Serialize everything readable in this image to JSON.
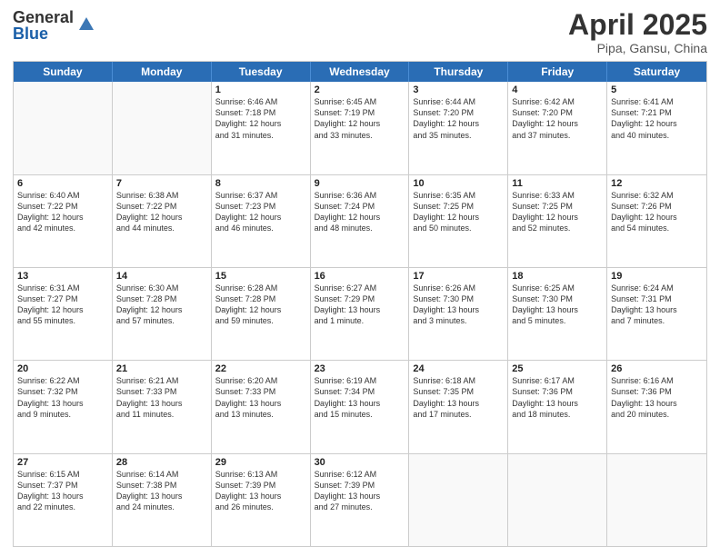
{
  "header": {
    "logo_general": "General",
    "logo_blue": "Blue",
    "title": "April 2025",
    "location": "Pipa, Gansu, China"
  },
  "weekdays": [
    "Sunday",
    "Monday",
    "Tuesday",
    "Wednesday",
    "Thursday",
    "Friday",
    "Saturday"
  ],
  "rows": [
    [
      {
        "day": "",
        "text": ""
      },
      {
        "day": "",
        "text": ""
      },
      {
        "day": "1",
        "text": "Sunrise: 6:46 AM\nSunset: 7:18 PM\nDaylight: 12 hours\nand 31 minutes."
      },
      {
        "day": "2",
        "text": "Sunrise: 6:45 AM\nSunset: 7:19 PM\nDaylight: 12 hours\nand 33 minutes."
      },
      {
        "day": "3",
        "text": "Sunrise: 6:44 AM\nSunset: 7:20 PM\nDaylight: 12 hours\nand 35 minutes."
      },
      {
        "day": "4",
        "text": "Sunrise: 6:42 AM\nSunset: 7:20 PM\nDaylight: 12 hours\nand 37 minutes."
      },
      {
        "day": "5",
        "text": "Sunrise: 6:41 AM\nSunset: 7:21 PM\nDaylight: 12 hours\nand 40 minutes."
      }
    ],
    [
      {
        "day": "6",
        "text": "Sunrise: 6:40 AM\nSunset: 7:22 PM\nDaylight: 12 hours\nand 42 minutes."
      },
      {
        "day": "7",
        "text": "Sunrise: 6:38 AM\nSunset: 7:22 PM\nDaylight: 12 hours\nand 44 minutes."
      },
      {
        "day": "8",
        "text": "Sunrise: 6:37 AM\nSunset: 7:23 PM\nDaylight: 12 hours\nand 46 minutes."
      },
      {
        "day": "9",
        "text": "Sunrise: 6:36 AM\nSunset: 7:24 PM\nDaylight: 12 hours\nand 48 minutes."
      },
      {
        "day": "10",
        "text": "Sunrise: 6:35 AM\nSunset: 7:25 PM\nDaylight: 12 hours\nand 50 minutes."
      },
      {
        "day": "11",
        "text": "Sunrise: 6:33 AM\nSunset: 7:25 PM\nDaylight: 12 hours\nand 52 minutes."
      },
      {
        "day": "12",
        "text": "Sunrise: 6:32 AM\nSunset: 7:26 PM\nDaylight: 12 hours\nand 54 minutes."
      }
    ],
    [
      {
        "day": "13",
        "text": "Sunrise: 6:31 AM\nSunset: 7:27 PM\nDaylight: 12 hours\nand 55 minutes."
      },
      {
        "day": "14",
        "text": "Sunrise: 6:30 AM\nSunset: 7:28 PM\nDaylight: 12 hours\nand 57 minutes."
      },
      {
        "day": "15",
        "text": "Sunrise: 6:28 AM\nSunset: 7:28 PM\nDaylight: 12 hours\nand 59 minutes."
      },
      {
        "day": "16",
        "text": "Sunrise: 6:27 AM\nSunset: 7:29 PM\nDaylight: 13 hours\nand 1 minute."
      },
      {
        "day": "17",
        "text": "Sunrise: 6:26 AM\nSunset: 7:30 PM\nDaylight: 13 hours\nand 3 minutes."
      },
      {
        "day": "18",
        "text": "Sunrise: 6:25 AM\nSunset: 7:30 PM\nDaylight: 13 hours\nand 5 minutes."
      },
      {
        "day": "19",
        "text": "Sunrise: 6:24 AM\nSunset: 7:31 PM\nDaylight: 13 hours\nand 7 minutes."
      }
    ],
    [
      {
        "day": "20",
        "text": "Sunrise: 6:22 AM\nSunset: 7:32 PM\nDaylight: 13 hours\nand 9 minutes."
      },
      {
        "day": "21",
        "text": "Sunrise: 6:21 AM\nSunset: 7:33 PM\nDaylight: 13 hours\nand 11 minutes."
      },
      {
        "day": "22",
        "text": "Sunrise: 6:20 AM\nSunset: 7:33 PM\nDaylight: 13 hours\nand 13 minutes."
      },
      {
        "day": "23",
        "text": "Sunrise: 6:19 AM\nSunset: 7:34 PM\nDaylight: 13 hours\nand 15 minutes."
      },
      {
        "day": "24",
        "text": "Sunrise: 6:18 AM\nSunset: 7:35 PM\nDaylight: 13 hours\nand 17 minutes."
      },
      {
        "day": "25",
        "text": "Sunrise: 6:17 AM\nSunset: 7:36 PM\nDaylight: 13 hours\nand 18 minutes."
      },
      {
        "day": "26",
        "text": "Sunrise: 6:16 AM\nSunset: 7:36 PM\nDaylight: 13 hours\nand 20 minutes."
      }
    ],
    [
      {
        "day": "27",
        "text": "Sunrise: 6:15 AM\nSunset: 7:37 PM\nDaylight: 13 hours\nand 22 minutes."
      },
      {
        "day": "28",
        "text": "Sunrise: 6:14 AM\nSunset: 7:38 PM\nDaylight: 13 hours\nand 24 minutes."
      },
      {
        "day": "29",
        "text": "Sunrise: 6:13 AM\nSunset: 7:39 PM\nDaylight: 13 hours\nand 26 minutes."
      },
      {
        "day": "30",
        "text": "Sunrise: 6:12 AM\nSunset: 7:39 PM\nDaylight: 13 hours\nand 27 minutes."
      },
      {
        "day": "",
        "text": ""
      },
      {
        "day": "",
        "text": ""
      },
      {
        "day": "",
        "text": ""
      }
    ]
  ]
}
